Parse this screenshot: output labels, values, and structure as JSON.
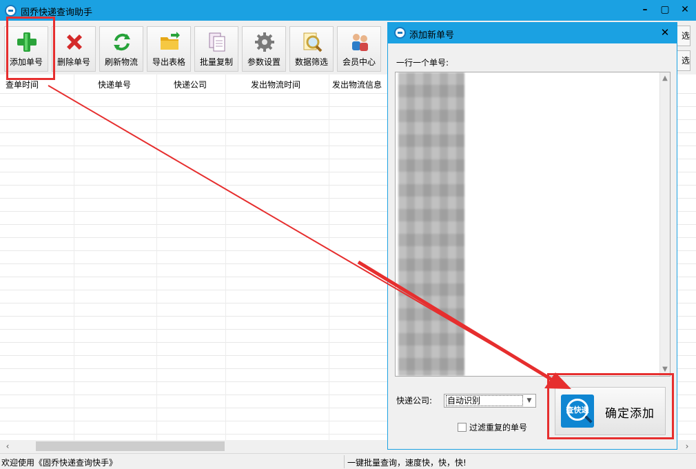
{
  "window": {
    "title": "固乔快递查询助手"
  },
  "toolbar": {
    "buttons": [
      {
        "label": "添加单号",
        "icon": "plus-icon"
      },
      {
        "label": "删除单号",
        "icon": "delete-x-icon"
      },
      {
        "label": "刷新物流",
        "icon": "refresh-icon"
      },
      {
        "label": "导出表格",
        "icon": "folder-export-icon"
      },
      {
        "label": "批量复制",
        "icon": "copy-icon"
      },
      {
        "label": "参数设置",
        "icon": "gear-icon"
      },
      {
        "label": "数据筛选",
        "icon": "magnifier-icon"
      },
      {
        "label": "会员中心",
        "icon": "users-icon"
      }
    ]
  },
  "side_chips": [
    "选",
    "选"
  ],
  "table": {
    "headers": [
      "查单时间",
      "快递单号",
      "快递公司",
      "发出物流时间",
      "发出物流信息"
    ]
  },
  "status": {
    "left": "欢迎使用《固乔快递查询快手》",
    "right": "一键批量查询，速度快，快，快!"
  },
  "dialog": {
    "title": "添加新单号",
    "input_label": "一行一个单号:",
    "company_label": "快递公司:",
    "company_value": "自动识别",
    "filter_label": "过滤重复的单号",
    "confirm_label": "确定添加",
    "logo_text": "查快递"
  },
  "colors": {
    "accent": "#1ba1e2",
    "annotation": "#e62e2e"
  }
}
